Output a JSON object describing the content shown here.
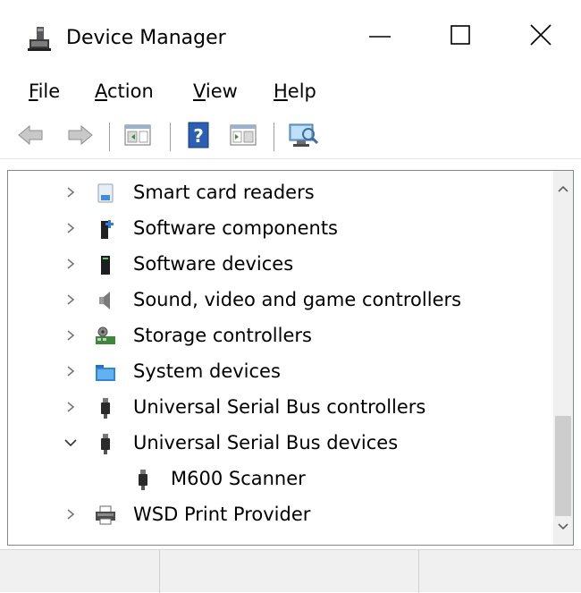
{
  "window": {
    "title": "Device Manager"
  },
  "menu": {
    "items": [
      {
        "accel": "F",
        "rest": "ile"
      },
      {
        "accel": "A",
        "rest": "ction"
      },
      {
        "accel": "V",
        "rest": "iew"
      },
      {
        "accel": "H",
        "rest": "elp"
      }
    ]
  },
  "toolbar": {
    "buttons": [
      "back-icon",
      "forward-icon",
      "properties-pane-icon",
      "help-icon",
      "action-pane-icon",
      "scan-hardware-icon"
    ]
  },
  "tree": {
    "items": [
      {
        "label": "Smart card readers",
        "icon": "smart-card-reader-icon",
        "state": "collapsed",
        "level": 0
      },
      {
        "label": "Software components",
        "icon": "software-component-icon",
        "state": "collapsed",
        "level": 0
      },
      {
        "label": "Software devices",
        "icon": "software-device-icon",
        "state": "collapsed",
        "level": 0
      },
      {
        "label": "Sound, video and game controllers",
        "icon": "speaker-icon",
        "state": "collapsed",
        "level": 0
      },
      {
        "label": "Storage controllers",
        "icon": "storage-controller-icon",
        "state": "collapsed",
        "level": 0
      },
      {
        "label": "System devices",
        "icon": "system-folder-icon",
        "state": "collapsed",
        "level": 0
      },
      {
        "label": "Universal Serial Bus controllers",
        "icon": "usb-icon",
        "state": "collapsed",
        "level": 0
      },
      {
        "label": "Universal Serial Bus devices",
        "icon": "usb-icon",
        "state": "expanded",
        "level": 0
      },
      {
        "label": "M600 Scanner",
        "icon": "usb-icon",
        "state": "leaf",
        "level": 1
      },
      {
        "label": "WSD Print Provider",
        "icon": "printer-icon",
        "state": "collapsed",
        "level": 0
      }
    ]
  },
  "colors": {
    "accent": "#2b6cc4",
    "scrollbar_thumb": "#cdcdcd",
    "statusbar": "#f0f0f0"
  }
}
